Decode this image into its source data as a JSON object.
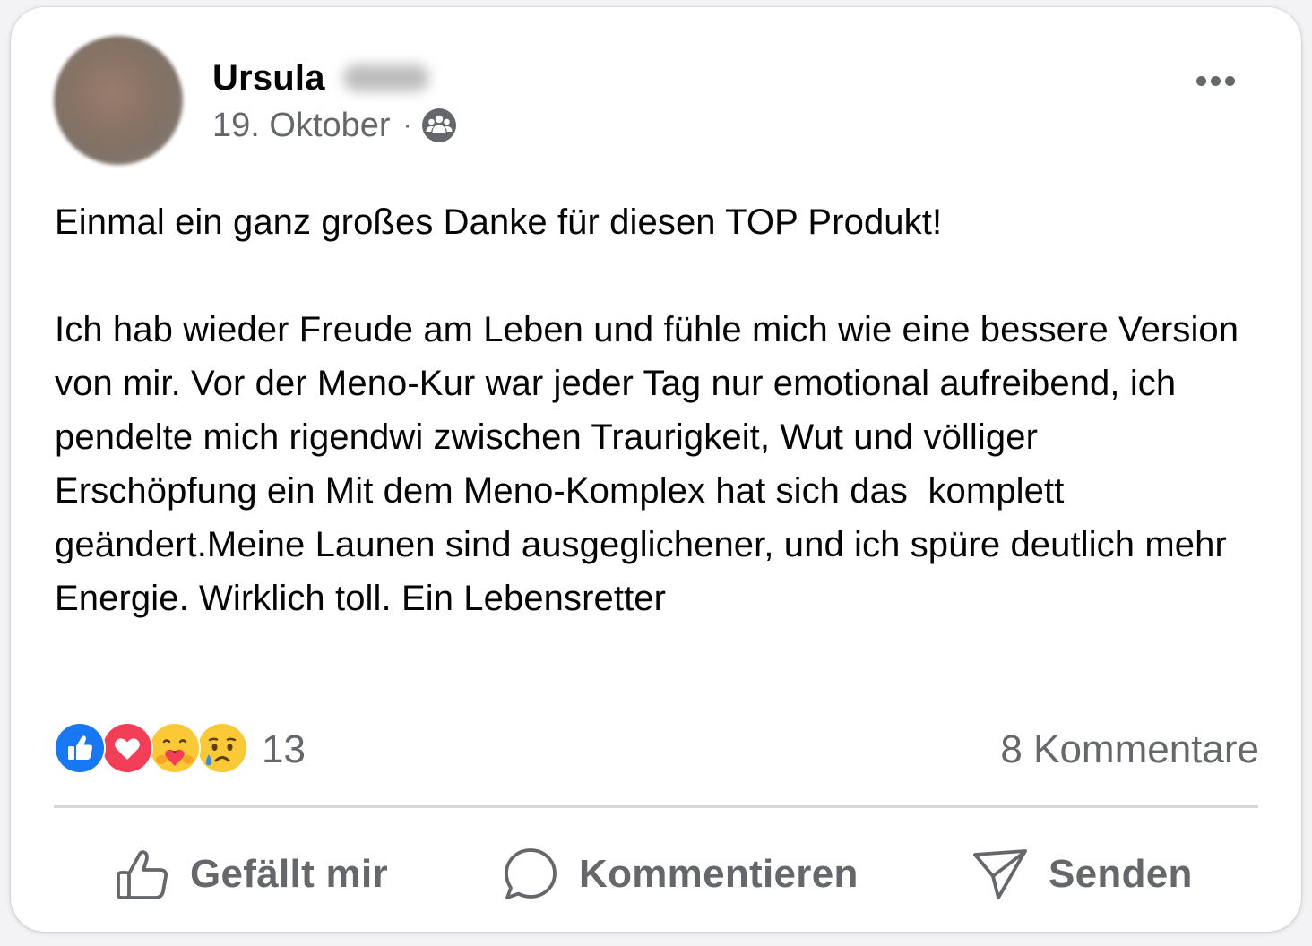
{
  "post": {
    "author_name": "Ursula",
    "date": "19. Oktober",
    "separator": "·",
    "audience_icon": "group-icon",
    "more_icon": "more-options-icon",
    "text": "Einmal ein ganz großes Danke für diesen TOP Produkt!\n\nIch hab wieder Freude am Leben und fühle mich wie eine bessere Version von mir. Vor der Meno-Kur war jeder Tag nur emotional aufreibend, ich pendelte mich rigendwi zwischen Traurigkeit, Wut und völliger Erschöpfung ein Mit dem Meno-Komplex hat sich das  komplett geändert.Meine Launen sind ausgeglichener, und ich spüre deutlich mehr  Energie. Wirklich toll. Ein Lebensretter"
  },
  "reactions": {
    "types": [
      "like",
      "love",
      "care",
      "sad"
    ],
    "count": "13",
    "comments_label": "8 Kommentare"
  },
  "actions": {
    "like_label": "Gefällt mir",
    "comment_label": "Kommentieren",
    "send_label": "Senden"
  },
  "colors": {
    "text": "#050505",
    "secondary": "#65676b",
    "like_blue": "#1877f2",
    "love_red": "#f33e58",
    "emoji_yellow": "#fbc935"
  }
}
